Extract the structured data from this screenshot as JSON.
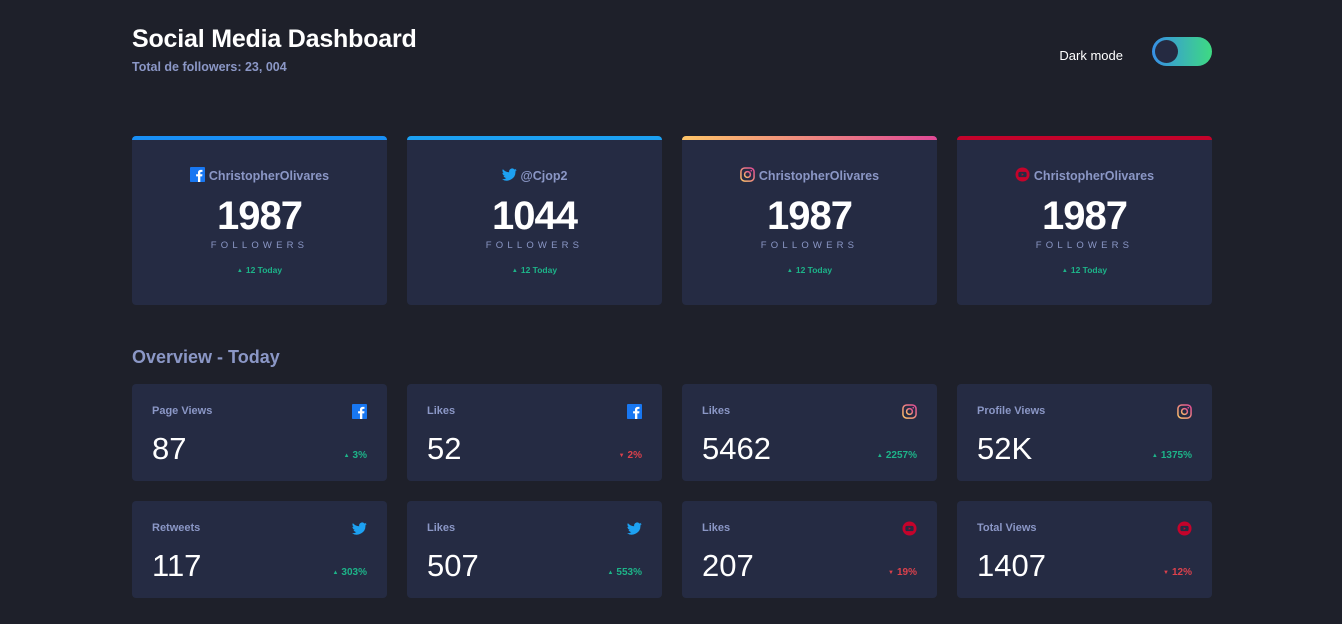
{
  "header": {
    "title": "Social Media Dashboard",
    "total_followers": "Total de followers: 23, 004",
    "dark_mode_label": "Dark mode"
  },
  "followers": [
    {
      "network": "facebook",
      "icon": "facebook-icon",
      "handle": "ChristopherOlivares",
      "count": "1987",
      "unit": "FOLLOWERS",
      "today": "12 Today",
      "trend": "up",
      "accent": "#198ff5"
    },
    {
      "network": "twitter",
      "icon": "twitter-icon",
      "handle": "@Cjop2",
      "count": "1044",
      "unit": "FOLLOWERS",
      "today": "12 Today",
      "trend": "up",
      "accent": "#1ca0f2"
    },
    {
      "network": "instagram",
      "icon": "instagram-icon",
      "handle": "ChristopherOlivares",
      "count": "1987",
      "unit": "FOLLOWERS",
      "today": "12 Today",
      "trend": "up",
      "accent": "#fdc468"
    },
    {
      "network": "youtube",
      "icon": "youtube-icon",
      "handle": "ChristopherOlivares",
      "count": "1987",
      "unit": "FOLLOWERS",
      "today": "12 Today",
      "trend": "up",
      "accent": "#c4032b"
    }
  ],
  "overview": {
    "title": "Overview - Today",
    "cards": [
      {
        "label": "Page Views",
        "icon": "facebook-icon",
        "value": "87",
        "pct": "3%",
        "trend": "up"
      },
      {
        "label": "Likes",
        "icon": "facebook-icon",
        "value": "52",
        "pct": "2%",
        "trend": "down"
      },
      {
        "label": "Likes",
        "icon": "instagram-icon",
        "value": "5462",
        "pct": "2257%",
        "trend": "up"
      },
      {
        "label": "Profile Views",
        "icon": "instagram-icon",
        "value": "52K",
        "pct": "1375%",
        "trend": "up"
      },
      {
        "label": "Retweets",
        "icon": "twitter-icon",
        "value": "117",
        "pct": "303%",
        "trend": "up"
      },
      {
        "label": "Likes",
        "icon": "twitter-icon",
        "value": "507",
        "pct": "553%",
        "trend": "up"
      },
      {
        "label": "Likes",
        "icon": "youtube-icon",
        "value": "207",
        "pct": "19%",
        "trend": "down"
      },
      {
        "label": "Total Views",
        "icon": "youtube-icon",
        "value": "1407",
        "pct": "12%",
        "trend": "down"
      }
    ]
  },
  "colors": {
    "background": "#1e202a",
    "card": "#252b43",
    "muted_text": "#8b97c6",
    "up": "#1db489",
    "down": "#dc414c",
    "toggle_gradient": [
      "#378fe6",
      "#3eda82"
    ]
  }
}
